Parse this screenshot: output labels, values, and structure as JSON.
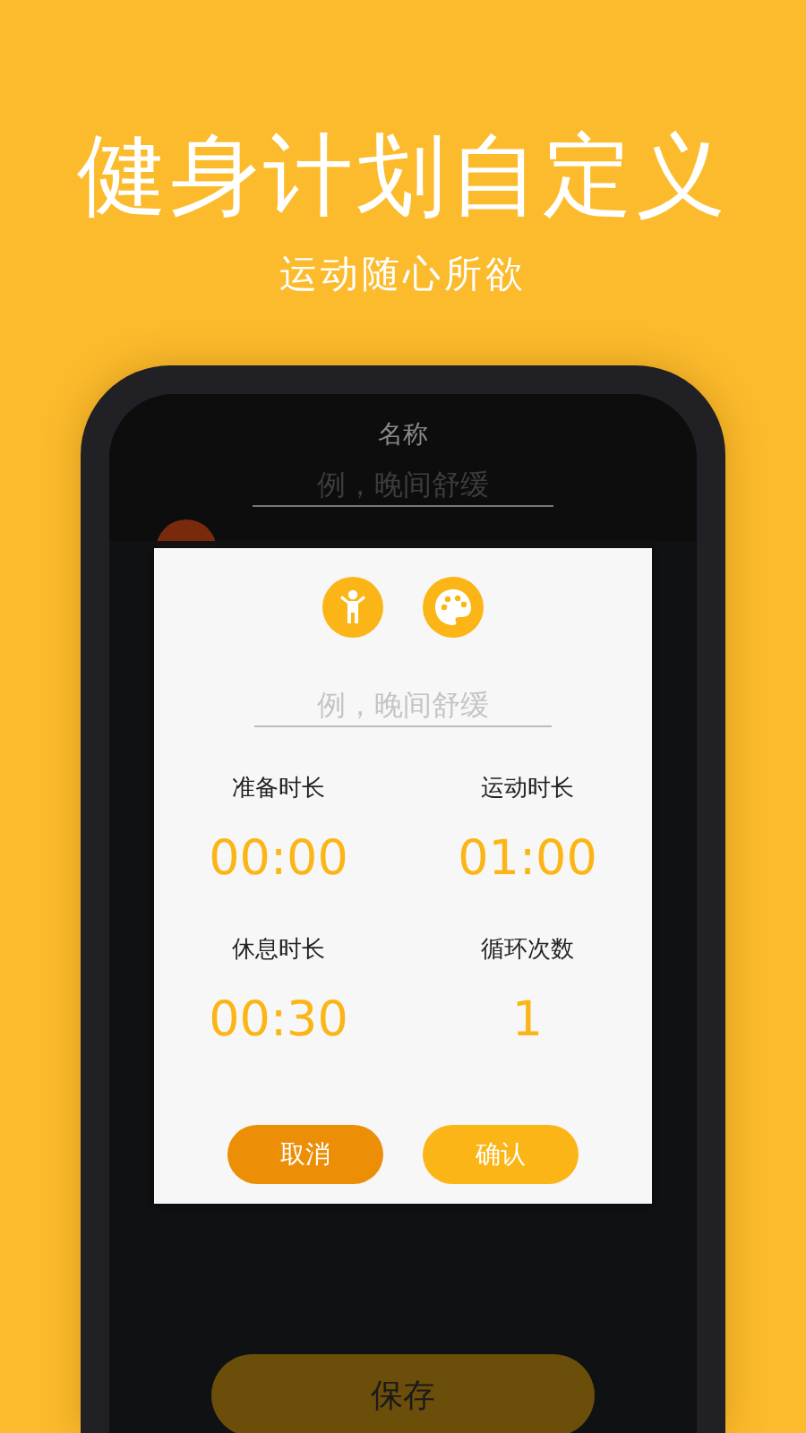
{
  "headline": "健身计划自定义",
  "subheadline": "运动随心所欲",
  "editor": {
    "title": "名称",
    "name_field": {
      "placeholder": "例，晚间舒缓"
    },
    "save_button": "保存"
  },
  "dialog": {
    "name_field": {
      "placeholder": "例，晚间舒缓"
    },
    "settings": [
      {
        "label": "准备时长",
        "value": "00:00"
      },
      {
        "label": "运动时长",
        "value": "01:00"
      },
      {
        "label": "休息时长",
        "value": "00:30"
      },
      {
        "label": "循环次数",
        "value": "1"
      }
    ],
    "buttons": [
      {
        "label": "取消",
        "kind": "cancel"
      },
      {
        "label": "确认",
        "kind": "confirm"
      }
    ]
  }
}
